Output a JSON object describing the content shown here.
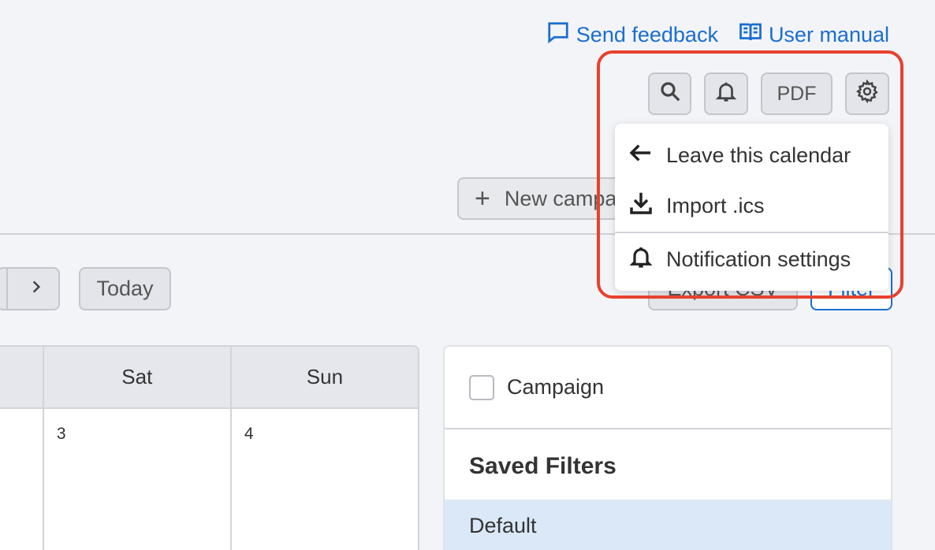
{
  "top_links": {
    "feedback": "Send feedback",
    "manual": "User manual"
  },
  "toolbar": {
    "pdf": "PDF",
    "new_campaign": "New campaign"
  },
  "nav": {
    "today": "Today",
    "export": "Export CSV",
    "filter": "Filter"
  },
  "calendar": {
    "days": [
      "Sat",
      "Sun"
    ],
    "dates": [
      "3",
      "4"
    ]
  },
  "filters_panel": {
    "campaign_label": "Campaign",
    "saved_title": "Saved Filters",
    "default_item": "Default"
  },
  "settings_menu": {
    "items": [
      "Leave this calendar",
      "Import .ics",
      "Notification settings"
    ]
  },
  "colors": {
    "accent": "#1a6ed0",
    "highlight": "#e8412e",
    "selected_row": "#dbe8f7"
  },
  "icons": [
    "feedback-icon",
    "book-icon",
    "search-icon",
    "bell-icon",
    "gear-icon",
    "plus-icon",
    "chevron-right-icon",
    "arrow-left-icon",
    "download-icon"
  ]
}
